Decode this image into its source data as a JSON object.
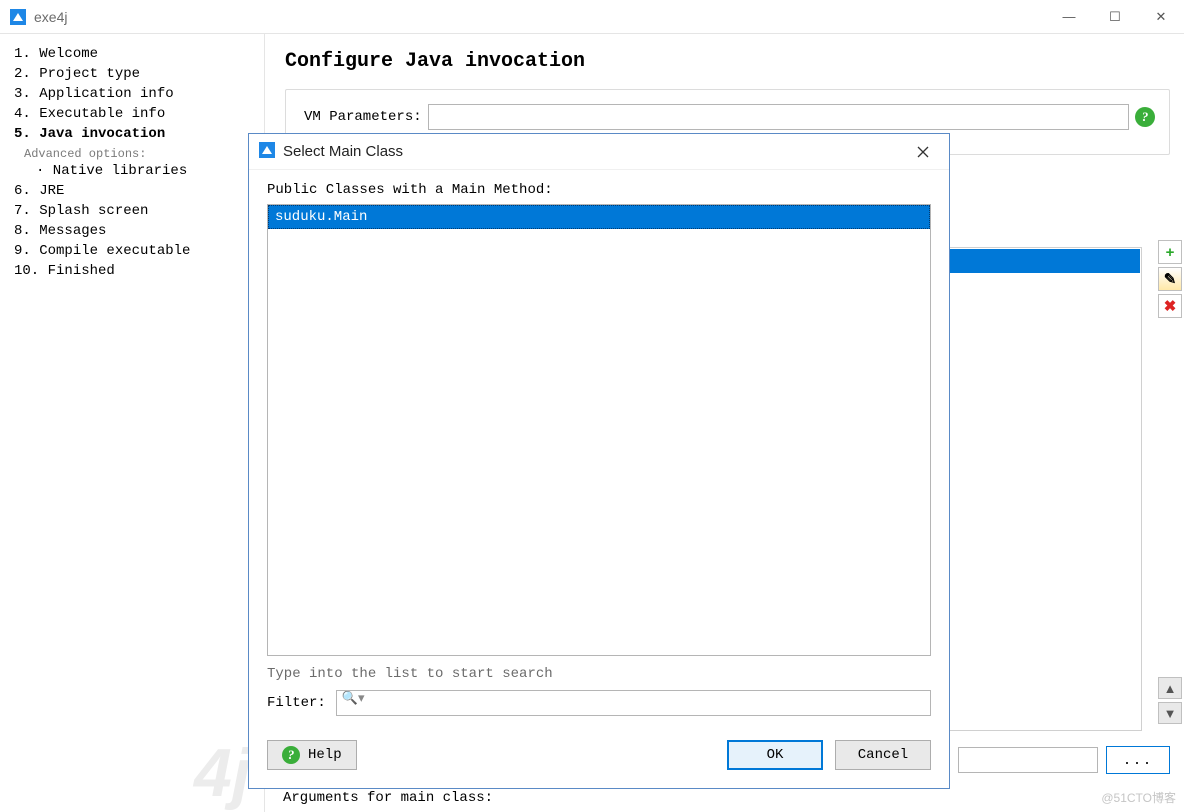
{
  "window": {
    "title": "exe4j",
    "controls": {
      "min": "—",
      "max": "☐",
      "close": "✕"
    }
  },
  "sidebar": {
    "steps": [
      {
        "num": "1.",
        "label": "Welcome"
      },
      {
        "num": "2.",
        "label": "Project type"
      },
      {
        "num": "3.",
        "label": "Application info"
      },
      {
        "num": "4.",
        "label": "Executable info"
      },
      {
        "num": "5.",
        "label": "Java invocation",
        "active": true
      },
      {
        "num": "6.",
        "label": "JRE"
      },
      {
        "num": "7.",
        "label": "Splash screen"
      },
      {
        "num": "8.",
        "label": "Messages"
      },
      {
        "num": "9.",
        "label": "Compile executable"
      },
      {
        "num": "10.",
        "label": "Finished"
      }
    ],
    "advanced_label": "Advanced options:",
    "advanced_sub": "· Native libraries"
  },
  "page": {
    "title": "Configure Java invocation",
    "vm_label": "VM Parameters:",
    "vm_value": "",
    "arguments_label": "Arguments for main class:",
    "ellipsis": "..."
  },
  "side_buttons": {
    "add": "+",
    "edit": "✎",
    "delete": "✖"
  },
  "arrows": {
    "up": "▲",
    "down": "▼"
  },
  "dialog": {
    "title": "Select Main Class",
    "close": "✕",
    "list_label": "Public Classes with a Main Method:",
    "selected_item": "suduku.Main",
    "hint": "Type into the list to start search",
    "filter_label": "Filter:",
    "filter_placeholder": "",
    "search_icon": "🔍",
    "help": "Help",
    "ok": "OK",
    "cancel": "Cancel",
    "help_glyph": "?"
  },
  "watermark": "@51CTO博客"
}
